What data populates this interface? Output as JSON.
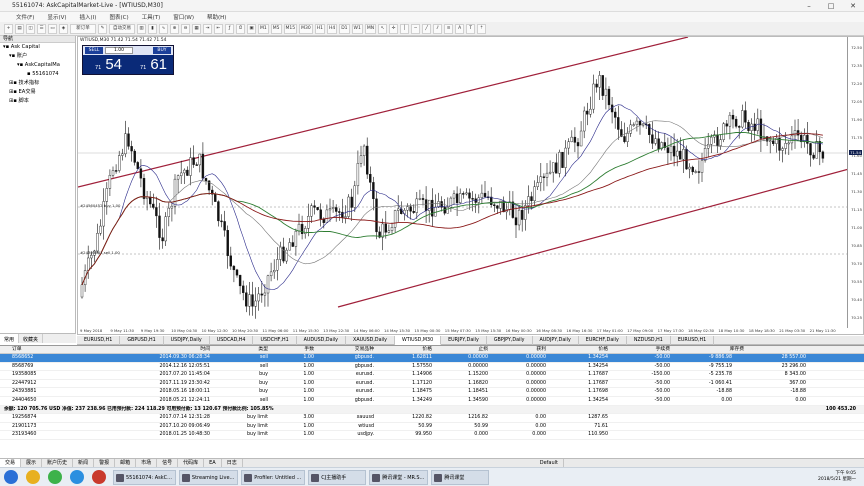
{
  "window": {
    "title": "55161074: AskCapitalMarket-Live - [WTIUSD,M30]"
  },
  "menu": [
    "文件(F)",
    "显示(V)",
    "插入(I)",
    "图表(C)",
    "工具(T)",
    "窗口(W)",
    "帮助(H)"
  ],
  "toolbar": {
    "new_order": "新订单",
    "auto_trading": "自动交易",
    "timeframes": [
      "M1",
      "M5",
      "M15",
      "M30",
      "H1",
      "H4",
      "D1",
      "W1",
      "MN"
    ]
  },
  "navigator": {
    "header": "导航",
    "items": [
      "Ask Capital",
      "账户",
      "AskCapitalMa",
      "55161074",
      "技术指标",
      "EA交易",
      "脚本"
    ],
    "tabs": [
      "常用",
      "收藏夹"
    ]
  },
  "chart": {
    "label": "WTIUSD,M30  71.42 71.54 71.42 71.54",
    "trade_panel": {
      "sell_label": "SELL",
      "buy_label": "BUY",
      "lot": "1.00",
      "sell_small": "71",
      "sell_big": "54",
      "buy_small": "71",
      "buy_big": "61"
    },
    "price_axis": [
      "72.50",
      "72.35",
      "72.20",
      "72.05",
      "71.90",
      "71.75",
      "71.60",
      "71.45",
      "71.30",
      "71.15",
      "71.00",
      "70.85",
      "70.70",
      "70.55",
      "70.40",
      "70.25"
    ],
    "current_price": "71.54",
    "time_axis": [
      "9 May 2018",
      "9 May 11:30",
      "9 May 19:30",
      "10 May 04:30",
      "10 May 12:30",
      "10 May 20:30",
      "11 May 06:00",
      "11 May 15:30",
      "13 May 22:30",
      "14 May 06:00",
      "14 May 15:30",
      "15 May 00:30",
      "15 May 07:30",
      "15 May 15:30",
      "16 May 00:30",
      "16 May 08:30",
      "16 May 16:30",
      "17 May 01:00",
      "17 May 09:00",
      "17 May 17:30",
      "18 May 02:30",
      "18 May 10:30",
      "18 May 18:30",
      "21 May 03:30",
      "21 May 11:30"
    ],
    "order_lines": [
      "#24560452 buy 1.00",
      "#24393881 sell 1.00"
    ]
  },
  "chart_tabs": [
    "EURUSD,H1",
    "GBPUSD,H1",
    "USDJPY,Daily",
    "USDCAD,H4",
    "USDCHF,H1",
    "AUDUSD,Daily",
    "XAUUSD,Daily",
    "WTIUSD,M30",
    "EURJPY,Daily",
    "GBPJPY,Daily",
    "AUDJPY,Daily",
    "EURCHF,Daily",
    "NZDUSD,H1",
    "EURUSD,H1"
  ],
  "terminal": {
    "headers": [
      "订单",
      "时间",
      "类型",
      "手数",
      "交易品种",
      "价格",
      "止损",
      "获利",
      "价格",
      "手续费",
      "库存费"
    ],
    "rows": [
      [
        "8568652",
        "2014.09.30 06:28:34",
        "sell",
        "1.00",
        "gbpusd.",
        "1.62811",
        "0.00000",
        "0.00000",
        "1.34254",
        "-50.00",
        "28 557.00"
      ],
      [
        "8568769",
        "2014.12.16 12:05:51",
        "sell",
        "1.00",
        "gbpusd.",
        "1.57550",
        "0.00000",
        "0.00000",
        "1.34254",
        "-50.00",
        "23 296.00"
      ],
      [
        "19358085",
        "2017.07.20 11:45:04",
        "buy",
        "1.00",
        "eurusd.",
        "1.14906",
        "1.15200",
        "0.00000",
        "1.17687",
        "-150.00",
        "8 343.00"
      ],
      [
        "22447912",
        "2017.11.19 23:30:42",
        "buy",
        "1.00",
        "eurusd.",
        "1.17120",
        "1.16820",
        "0.00000",
        "1.17687",
        "-50.00",
        "367.00"
      ],
      [
        "24393881",
        "2018.05.16 18:00:11",
        "buy",
        "1.00",
        "eurusd.",
        "1.18475",
        "1.18451",
        "0.00000",
        "1.17698",
        "-50.00",
        "-18.88"
      ],
      [
        "24404650",
        "2018.05.21 12:24:11",
        "sell",
        "1.00",
        "gbpusd.",
        "1.34249",
        "1.34590",
        "0.00000",
        "1.34254",
        "-50.00",
        "0.00"
      ]
    ],
    "pl_values": [
      "-9 886.98",
      "-9 755.19",
      "-5 235.78",
      "-1 060.41",
      "-18.88",
      "0.00"
    ],
    "summary": "余额: 120 705.76 USD  净值: 237 238.96  已用预付款: 224 118.29  可用预付款: 13 120.67  预付款比例: 105.85%",
    "summary_value": "100 453.20",
    "pending": [
      [
        "19256874",
        "2017.07.14 12:31:28",
        "buy limit",
        "3.00",
        "xauusd",
        "1220.82",
        "1216.82",
        "0.00",
        "1287.65"
      ],
      [
        "21901173",
        "2017.10.20 09:06:49",
        "buy limit",
        "1.00",
        "wtiusd",
        "50.99",
        "50.99",
        "0.00",
        "71.61"
      ],
      [
        "23193460",
        "2018.01.25 10:48:30",
        "buy limit",
        "1.00",
        "usdjpy.",
        "99.950",
        "0.000",
        "0.000",
        "110.950"
      ]
    ],
    "tabs": [
      "交易",
      "展示",
      "账户历史",
      "新闻",
      "警报",
      "邮箱",
      "市场",
      "信号",
      "代码库",
      "EA",
      "日志"
    ],
    "status": "Default"
  },
  "taskbar": {
    "apps": [
      "55161074: AskC...",
      "Streaming Live...",
      "Profiler: Untitled ...",
      "CJ主播助手",
      "腾讯课堂 - MR.S...",
      "腾讯课堂"
    ],
    "time": "下午 9:05",
    "date": "2018/5/21 星期一"
  }
}
